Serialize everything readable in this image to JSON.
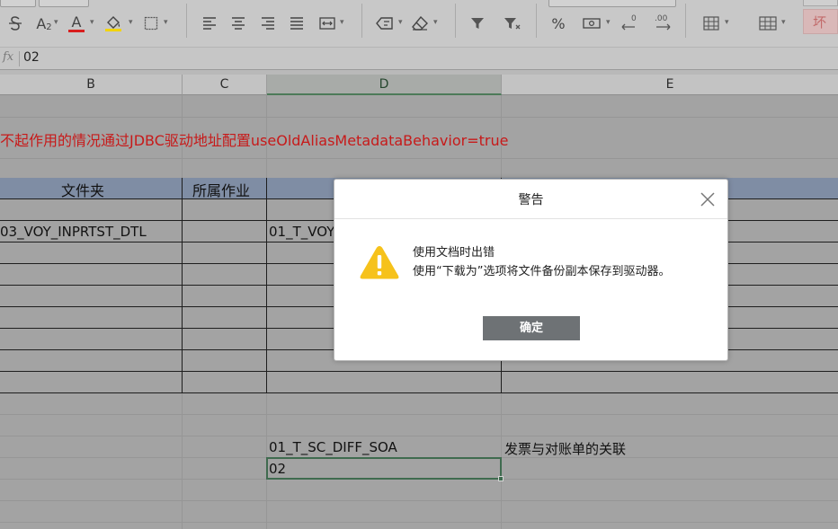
{
  "toolbar": {
    "icons": [
      "strikethrough-icon",
      "subscript-icon",
      "font-color-icon",
      "fill-color-icon",
      "borders-icon",
      "align-left-icon",
      "align-center-icon",
      "align-right-icon",
      "justify-icon",
      "merge-cells-icon",
      "wrap-text-icon",
      "clear-icon",
      "filter-icon",
      "clear-filter-icon",
      "percent-icon",
      "currency-icon",
      "decrease-decimal-icon",
      "increase-decimal-icon",
      "insert-cells-icon",
      "table-style-icon"
    ],
    "subscript_label": "A",
    "subscript_sub": "2",
    "font_color_label": "A",
    "percent_label": "%",
    "decrease_decimal_sub": "0",
    "increase_decimal_sub": ".00",
    "status_badge": "坏",
    "colors": {
      "font_color_bar": "#d81e1e",
      "fill_color_bar": "#f2d300"
    }
  },
  "formula_bar": {
    "fx_label": "fx",
    "value": "02"
  },
  "columns": [
    "B",
    "C",
    "D",
    "E"
  ],
  "selected_column": "D",
  "sheet": {
    "note": "不起作用的情况通过JDBC驱动地址配置useOldAliasMetadataBehavior=true",
    "headers": {
      "folder": "文件夹",
      "job": "所属作业"
    },
    "row1": {
      "b": "03_VOY_INPRTST_DTL",
      "d": "01_T_VOY"
    },
    "row2": {
      "d": "01_T_SC_DIFF_SOA",
      "e": "发票与对账单的关联"
    },
    "row3": {
      "d": "02"
    }
  },
  "dialog": {
    "title": "警告",
    "message_line1": "使用文档时出错",
    "message_line2": "使用“下载为”选项将文件备份副本保存到驱动器。",
    "ok_label": "确定"
  },
  "colors": {
    "note_text": "#c71a1a",
    "header_band": "#7f8da4",
    "selection": "#3f6b4f"
  }
}
